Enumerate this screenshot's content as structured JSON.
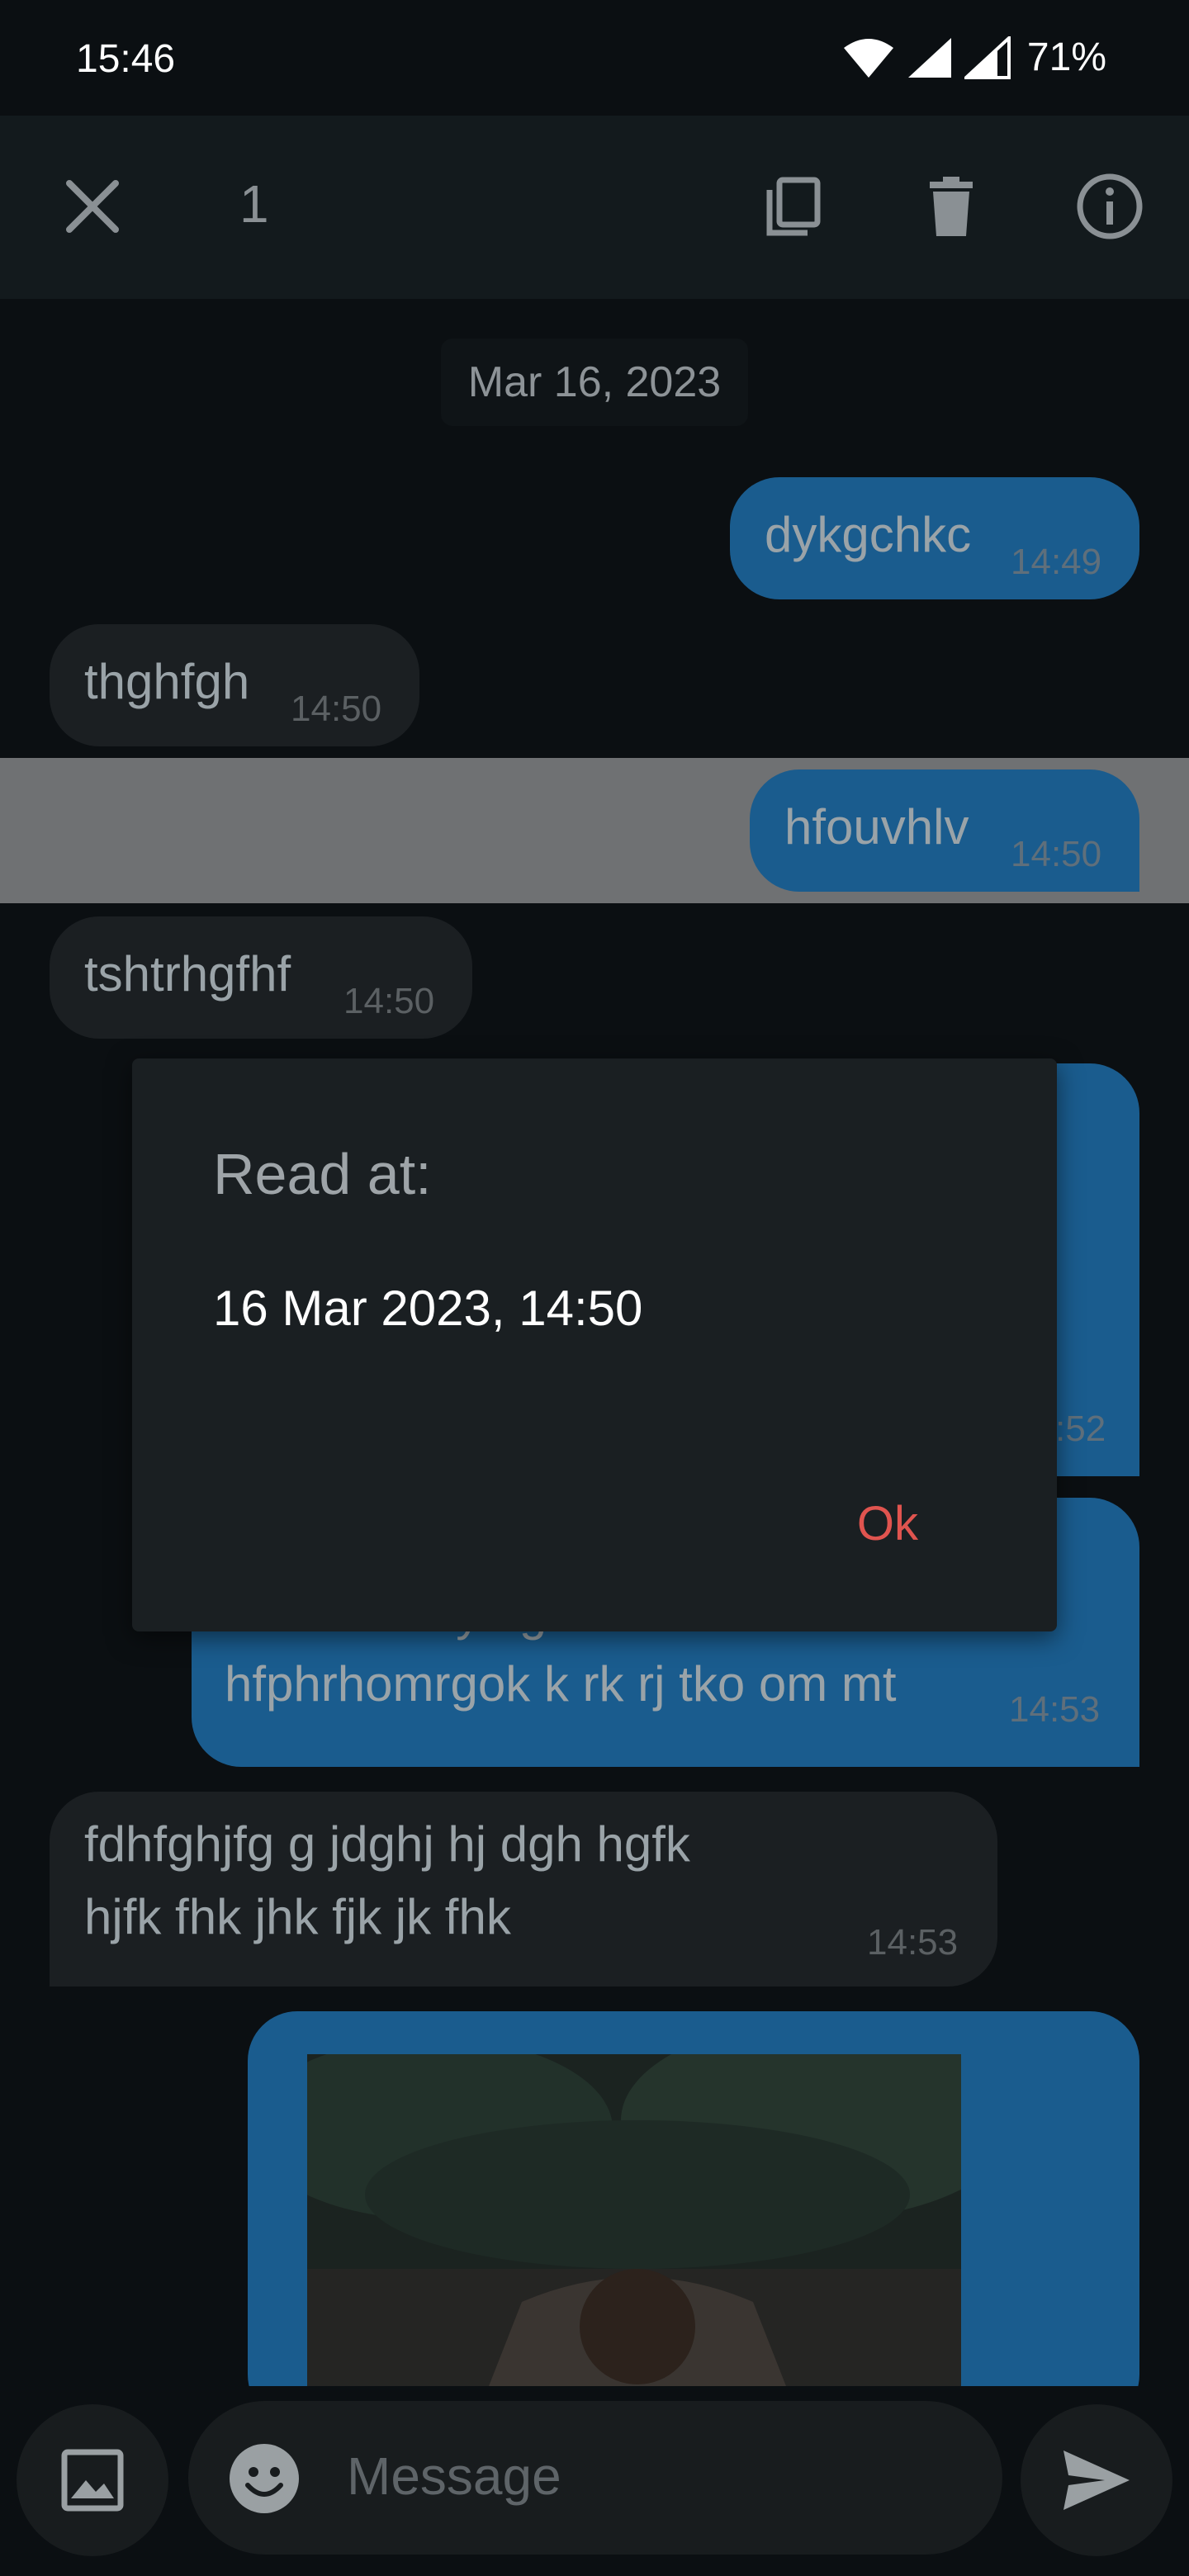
{
  "status_bar": {
    "time": "15:46",
    "battery": "71%"
  },
  "toolbar": {
    "selected_count": "1"
  },
  "chat": {
    "date_chip": "Mar 16, 2023",
    "messages": [
      {
        "dir": "out",
        "text": "dykgchkc",
        "time": "14:49"
      },
      {
        "dir": "in",
        "text": "thghfgh",
        "time": "14:50"
      },
      {
        "dir": "out",
        "text": "hfouvhlv",
        "time": "14:50",
        "selected": true
      },
      {
        "dir": "in",
        "text": "tshtrhgfhf",
        "time": "14:50"
      },
      {
        "dir": "out",
        "text": "",
        "time": ":52"
      },
      {
        "dir": "out",
        "text_line1": "hdohi rohi yhig rohihio ihirohi",
        "text_line2": "hfphrhomrgok k rk rj tko om mt",
        "time": "14:53"
      },
      {
        "dir": "in",
        "text_line1": "fdhfghjfg g jdghj hj dgh hgfk",
        "text_line2": "hjfk fhk jhk fjk jk fhk",
        "time": "14:53"
      }
    ]
  },
  "dialog": {
    "title": "Read at:",
    "body": "16 Mar 2023, 14:50",
    "ok": "Ok"
  },
  "composer": {
    "placeholder": "Message"
  }
}
